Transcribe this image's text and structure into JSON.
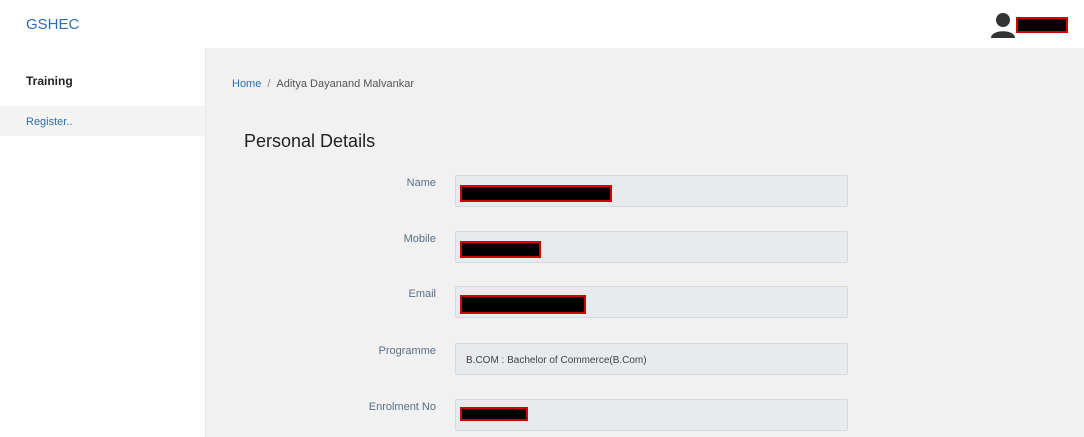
{
  "header": {
    "brand": "GSHEC",
    "user_icon": "user-avatar-icon"
  },
  "sidebar": {
    "heading": "Training",
    "items": [
      {
        "label": "Register.."
      }
    ]
  },
  "breadcrumb": {
    "home": "Home",
    "separator": "/",
    "current": "Aditya Dayanand Malvankar"
  },
  "main": {
    "title": "Personal Details",
    "fields": [
      {
        "label": "Name",
        "value": "",
        "redacted": true
      },
      {
        "label": "Mobile",
        "value": "",
        "redacted": true
      },
      {
        "label": "Email",
        "value": "",
        "redacted": true
      },
      {
        "label": "Programme",
        "value": "B.COM : Bachelor of Commerce(B.Com)",
        "redacted": false
      },
      {
        "label": "Enrolment No",
        "value": "",
        "redacted": true
      }
    ]
  },
  "colors": {
    "link": "#2a6fb5",
    "main_bg": "#f1f1f1",
    "field_bg": "#e8eaee",
    "redaction_border": "#d40000"
  }
}
